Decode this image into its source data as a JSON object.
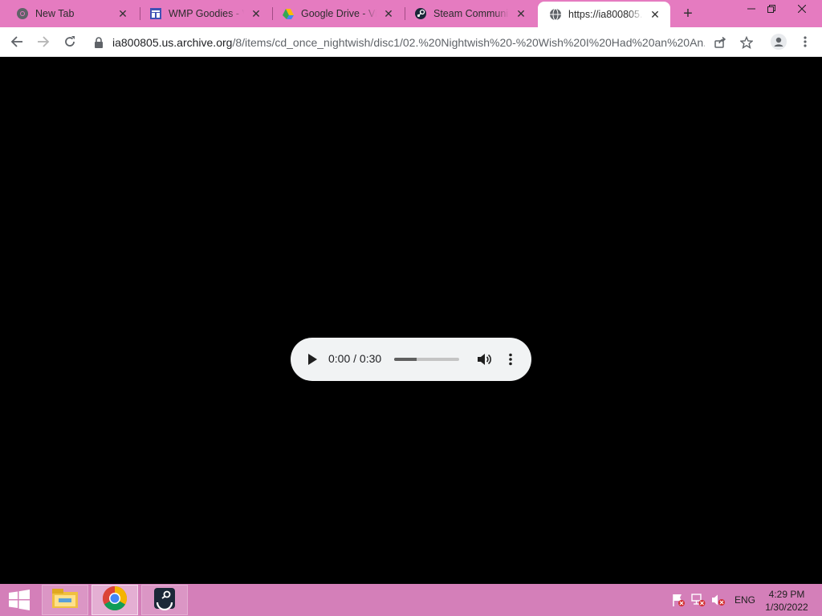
{
  "browser": {
    "tabs": [
      {
        "title": "New Tab",
        "icon": "chrome-icon"
      },
      {
        "title": "WMP Goodies - Vi",
        "icon": "site-icon"
      },
      {
        "title": "Google Drive - Vir",
        "icon": "google-drive-icon"
      },
      {
        "title": "Steam Community",
        "icon": "steam-icon"
      },
      {
        "title": "https://ia800805.us",
        "icon": "globe-icon",
        "active": true
      }
    ],
    "new_tab_label": "+",
    "address": {
      "host": "ia800805.us.archive.org",
      "path": "/8/items/cd_once_nightwish/disc1/02.%20Nightwish%20-%20Wish%20I%20Had%20an%20An..."
    }
  },
  "player": {
    "current_time": "0:00",
    "separator": " / ",
    "duration": "0:30",
    "buffered_fraction": 0.35
  },
  "taskbar": {
    "apps": [
      {
        "name": "file-explorer-icon"
      },
      {
        "name": "chrome-icon",
        "active": true
      },
      {
        "name": "steam-icon"
      }
    ],
    "language": "ENG",
    "time": "4:29 PM",
    "date": "1/30/2022"
  },
  "colors": {
    "tabstrip": "#e57bc0",
    "taskbar": "#d47fb9",
    "content_bg": "#000000",
    "player_bg": "#f1f3f4"
  }
}
